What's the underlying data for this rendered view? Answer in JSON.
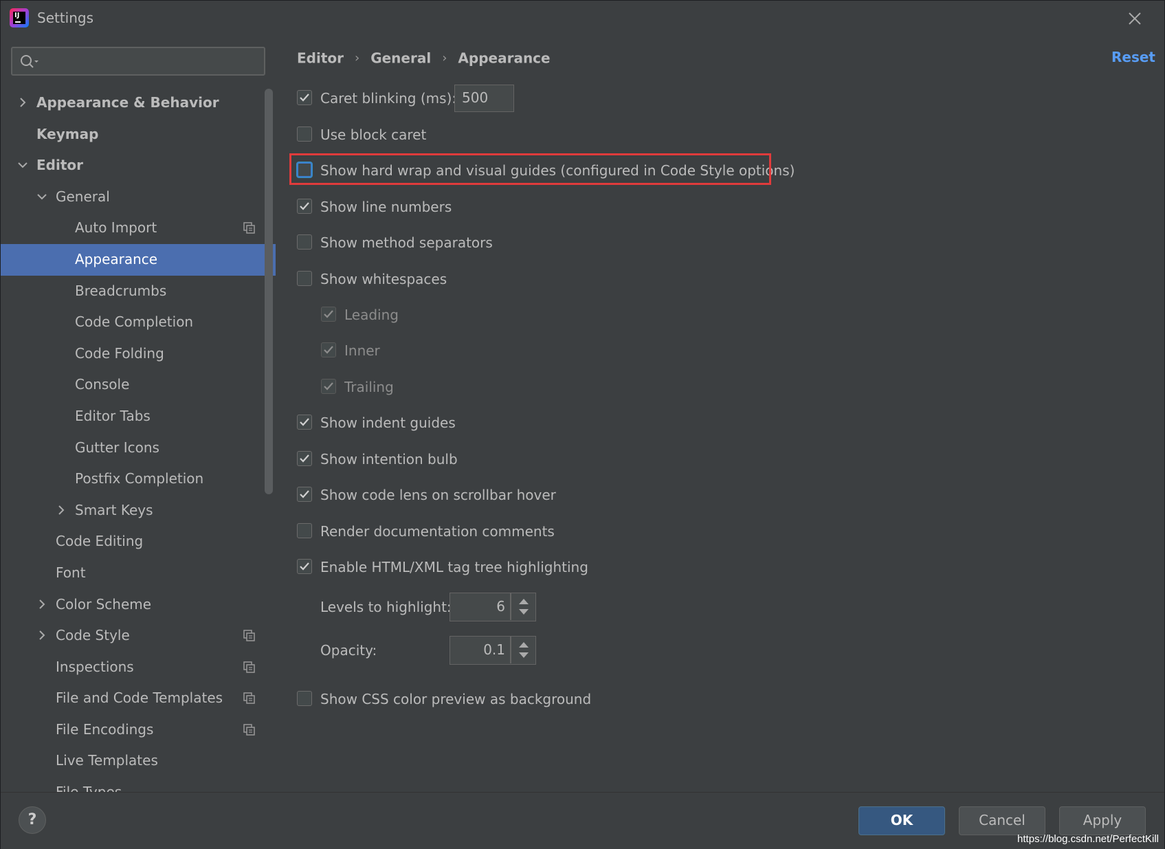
{
  "window": {
    "title": "Settings",
    "app_icon": "intellij-logo",
    "app_icon_text": "IJ"
  },
  "search": {
    "placeholder": "",
    "value": ""
  },
  "sidebar": {
    "items": [
      {
        "label": "Appearance & Behavior",
        "bold": true,
        "expander": "collapsed",
        "level": 0
      },
      {
        "label": "Keymap",
        "bold": true,
        "expander": "none",
        "level": 0
      },
      {
        "label": "Editor",
        "bold": true,
        "expander": "expanded",
        "level": 0
      },
      {
        "label": "General",
        "bold": false,
        "expander": "expanded",
        "level": 1
      },
      {
        "label": "Auto Import",
        "bold": false,
        "expander": "none",
        "level": 2,
        "project_icon": true
      },
      {
        "label": "Appearance",
        "bold": false,
        "expander": "none",
        "level": 2,
        "selected": true
      },
      {
        "label": "Breadcrumbs",
        "bold": false,
        "expander": "none",
        "level": 2
      },
      {
        "label": "Code Completion",
        "bold": false,
        "expander": "none",
        "level": 2
      },
      {
        "label": "Code Folding",
        "bold": false,
        "expander": "none",
        "level": 2
      },
      {
        "label": "Console",
        "bold": false,
        "expander": "none",
        "level": 2
      },
      {
        "label": "Editor Tabs",
        "bold": false,
        "expander": "none",
        "level": 2
      },
      {
        "label": "Gutter Icons",
        "bold": false,
        "expander": "none",
        "level": 2
      },
      {
        "label": "Postfix Completion",
        "bold": false,
        "expander": "none",
        "level": 2
      },
      {
        "label": "Smart Keys",
        "bold": false,
        "expander": "collapsed",
        "level": 2
      },
      {
        "label": "Code Editing",
        "bold": false,
        "expander": "none",
        "level": 1
      },
      {
        "label": "Font",
        "bold": false,
        "expander": "none",
        "level": 1
      },
      {
        "label": "Color Scheme",
        "bold": false,
        "expander": "collapsed",
        "level": 1
      },
      {
        "label": "Code Style",
        "bold": false,
        "expander": "collapsed",
        "level": 1,
        "project_icon": true
      },
      {
        "label": "Inspections",
        "bold": false,
        "expander": "none",
        "level": 1,
        "project_icon": true
      },
      {
        "label": "File and Code Templates",
        "bold": false,
        "expander": "none",
        "level": 1,
        "project_icon": true
      },
      {
        "label": "File Encodings",
        "bold": false,
        "expander": "none",
        "level": 1,
        "project_icon": true
      },
      {
        "label": "Live Templates",
        "bold": false,
        "expander": "none",
        "level": 1
      },
      {
        "label": "File Types",
        "bold": false,
        "expander": "none",
        "level": 1
      }
    ]
  },
  "breadcrumb": {
    "items": [
      "Editor",
      "General",
      "Appearance"
    ]
  },
  "reset_label": "Reset",
  "options": {
    "caret_blinking": {
      "label": "Caret blinking (ms):",
      "checked": true,
      "value": "500"
    },
    "block_caret": {
      "label": "Use block caret",
      "checked": false
    },
    "hard_wrap": {
      "label": "Show hard wrap and visual guides (configured in Code Style options)",
      "checked": false,
      "highlighted": true
    },
    "line_numbers": {
      "label": "Show line numbers",
      "checked": true
    },
    "method_separators": {
      "label": "Show method separators",
      "checked": false
    },
    "whitespaces": {
      "label": "Show whitespaces",
      "checked": false
    },
    "leading": {
      "label": "Leading",
      "checked": true,
      "disabled": true
    },
    "inner": {
      "label": "Inner",
      "checked": true,
      "disabled": true
    },
    "trailing": {
      "label": "Trailing",
      "checked": true,
      "disabled": true
    },
    "indent_guides": {
      "label": "Show indent guides",
      "checked": true
    },
    "intention_bulb": {
      "label": "Show intention bulb",
      "checked": true
    },
    "code_lens": {
      "label": "Show code lens on scrollbar hover",
      "checked": true
    },
    "render_docs": {
      "label": "Render documentation comments",
      "checked": false
    },
    "tag_tree": {
      "label": "Enable HTML/XML tag tree highlighting",
      "checked": true
    },
    "levels": {
      "label": "Levels to highlight:",
      "value": "6"
    },
    "opacity": {
      "label": "Opacity:",
      "value": "0.1"
    },
    "css_preview": {
      "label": "Show CSS color preview as background",
      "checked": false
    }
  },
  "footer": {
    "help_label": "?",
    "ok_label": "OK",
    "cancel_label": "Cancel",
    "apply_label": "Apply"
  },
  "watermark": "https://blog.csdn.net/PerfectKill",
  "colors": {
    "background": "#3c3f41",
    "selection": "#4b6eaf",
    "accent_link": "#589df6",
    "highlight_border": "#e03b3b",
    "primary_button": "#365880"
  }
}
